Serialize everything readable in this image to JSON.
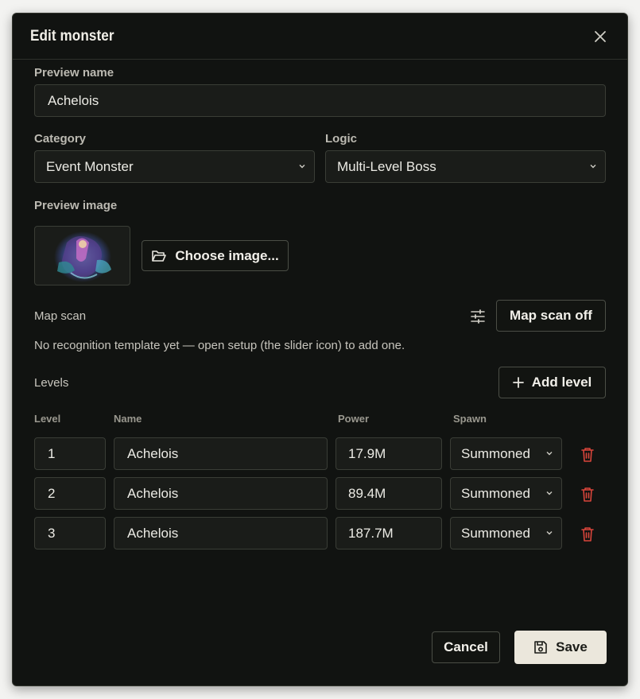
{
  "modal": {
    "title": "Edit monster",
    "close_icon": "close-icon"
  },
  "preview_name": {
    "label": "Preview name",
    "value": "Achelois"
  },
  "category": {
    "label": "Category",
    "value": "Event Monster"
  },
  "logic": {
    "label": "Logic",
    "value": "Multi-Level Boss"
  },
  "preview_image": {
    "label": "Preview image",
    "button_label": "Choose image...",
    "button_icon": "folder-open-icon"
  },
  "map_scan": {
    "label": "Map scan",
    "settings_icon": "sliders-icon",
    "toggle_label": "Map scan off",
    "hint": "No recognition template yet — open setup (the slider icon) to add one."
  },
  "levels": {
    "label": "Levels",
    "add_label": "Add level",
    "columns": {
      "level": "Level",
      "name": "Name",
      "power": "Power",
      "spawn": "Spawn"
    },
    "rows": [
      {
        "level": "1",
        "name": "Achelois",
        "power": "17.9M",
        "spawn": "Summoned"
      },
      {
        "level": "2",
        "name": "Achelois",
        "power": "89.4M",
        "spawn": "Summoned"
      },
      {
        "level": "3",
        "name": "Achelois",
        "power": "187.7M",
        "spawn": "Summoned"
      }
    ]
  },
  "footer": {
    "cancel_label": "Cancel",
    "save_label": "Save",
    "save_icon": "save-icon"
  },
  "colors": {
    "background": "#111311",
    "border": "#3a3d36",
    "danger": "#d9453b",
    "primary_button": "#ebe7dc"
  }
}
